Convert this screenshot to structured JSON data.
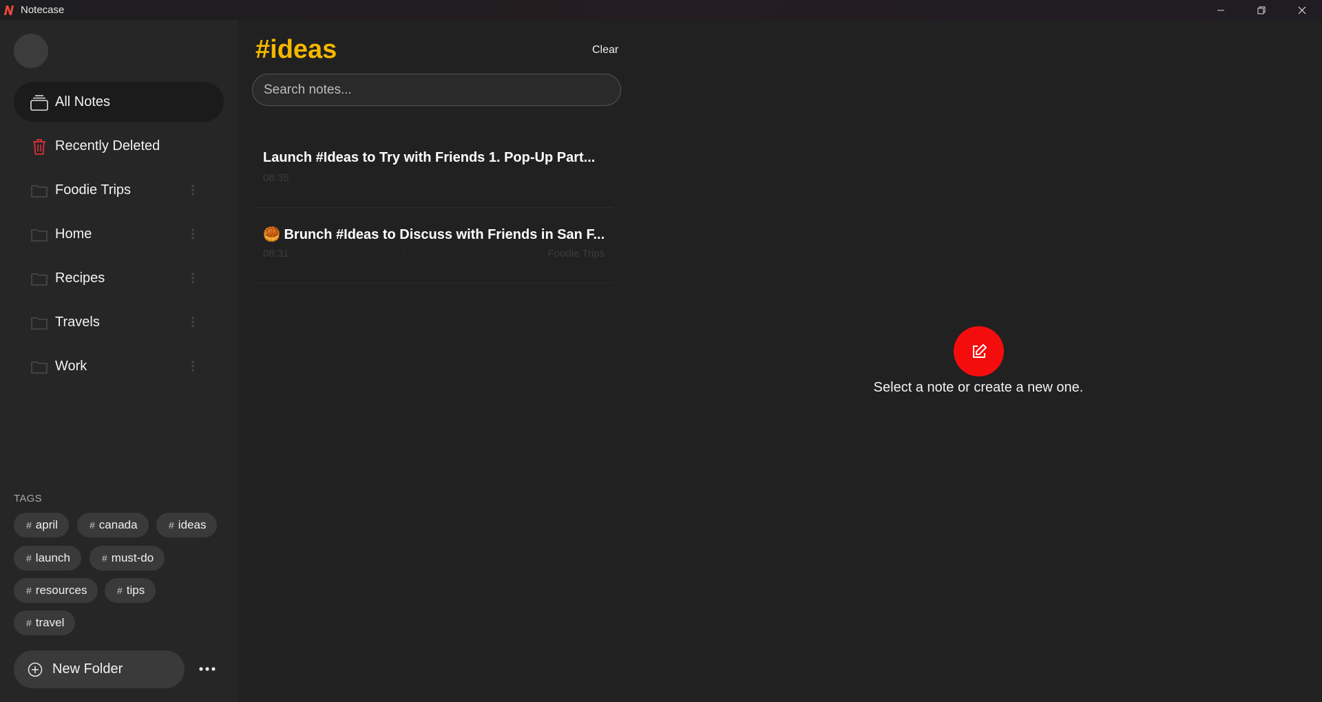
{
  "app": {
    "title": "Notecase"
  },
  "sidebar": {
    "nav": [
      {
        "label": "All Notes",
        "icon": "stack-icon"
      },
      {
        "label": "Recently Deleted",
        "icon": "trash-icon"
      }
    ],
    "folders": [
      {
        "label": "Foodie Trips"
      },
      {
        "label": "Home"
      },
      {
        "label": "Recipes"
      },
      {
        "label": "Travels"
      },
      {
        "label": "Work"
      }
    ],
    "tags_title": "TAGS",
    "tags": [
      "april",
      "canada",
      "ideas",
      "launch",
      "must-do",
      "resources",
      "tips",
      "travel"
    ],
    "tag_hash": "#",
    "new_folder_label": "New Folder"
  },
  "list": {
    "title": "#ideas",
    "clear_label": "Clear",
    "search_placeholder": "Search notes...",
    "notes": [
      {
        "title": "Launch #Ideas to Try with Friends 1. Pop-Up Part...",
        "time": "08:35",
        "folder": ""
      },
      {
        "emoji": "🥮",
        "title": "Brunch #Ideas to Discuss with Friends in San F...",
        "time": "08:31",
        "dot": "·",
        "folder": "Foodie Trips"
      }
    ]
  },
  "empty": {
    "message": "Select a note or create a new one."
  },
  "colors": {
    "accent_title": "#f5b800",
    "fab": "#f50d0d",
    "trash": "#e0303a"
  }
}
